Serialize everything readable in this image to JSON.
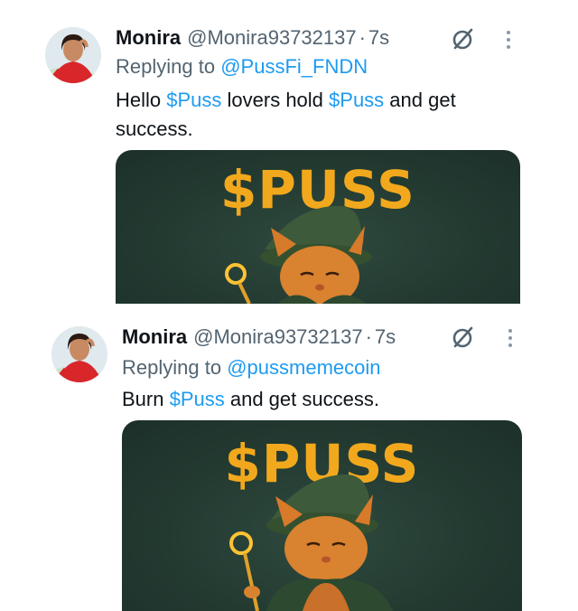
{
  "tweets": [
    {
      "name": "Monira",
      "handle": "@Monira93732137",
      "separator": "·",
      "time": "7s",
      "replying_prefix": "Replying to",
      "replying_to": "@PussFi_FNDN",
      "text_parts": [
        "Hello ",
        "$Puss",
        " lovers hold ",
        "$Puss",
        " and get success."
      ],
      "media_title": "$PUSS"
    },
    {
      "name": "Monira",
      "handle": "@Monira93732137",
      "separator": "·",
      "time": "7s",
      "replying_prefix": "Replying to",
      "replying_to": "@pussmemecoin",
      "text_parts": [
        "Burn ",
        "$Puss",
        " and get success."
      ],
      "media_title": "$PUSS"
    }
  ],
  "icons": {
    "grok": "grok-slash-circle-icon",
    "more": "more-vertical-icon"
  },
  "colors": {
    "link": "#1d9bf0",
    "secondary": "#536471",
    "title_orange": "#f2a81d",
    "media_bg": "#233a31"
  }
}
